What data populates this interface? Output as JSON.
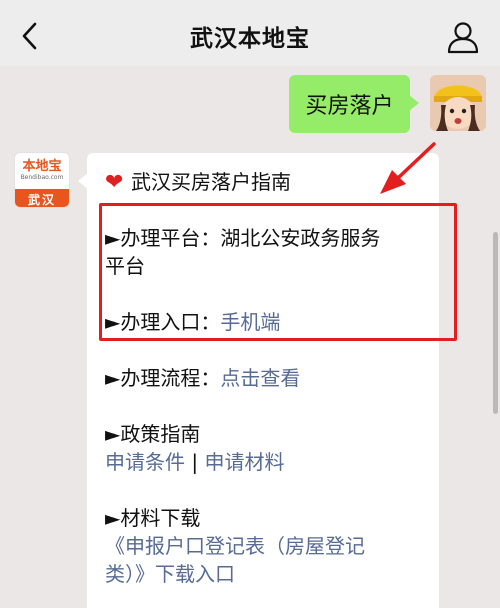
{
  "nav": {
    "title": "武汉本地宝"
  },
  "outgoing": {
    "text": "买房落户"
  },
  "bot": {
    "logo_text": "本地宝",
    "logo_sub": "Bendibao.com",
    "city": "武汉"
  },
  "message": {
    "heading": "武汉买房落户指南",
    "platform_label": "►办理平台：",
    "platform_value_1": "湖北公安政务服务",
    "platform_value_2": "平台",
    "entry_label": "►办理入口：",
    "entry_link": "手机端",
    "process_label": "►办理流程：",
    "process_link": "点击查看",
    "policy_label": "►政策指南",
    "policy_link_1": "申请条件",
    "policy_sep": " | ",
    "policy_link_2": "申请材料",
    "download_label": "►材料下载",
    "download_link_1": "《申报户口登记表（房屋登记",
    "download_link_2": "类）》下载入口"
  },
  "colors": {
    "highlight_box": "#e41e1e",
    "link": "#576b95",
    "outgoing_bubble": "#95ec69"
  },
  "icons": [
    "back-arrow-icon",
    "person-icon",
    "heart-icon",
    "red-arrow-icon"
  ]
}
